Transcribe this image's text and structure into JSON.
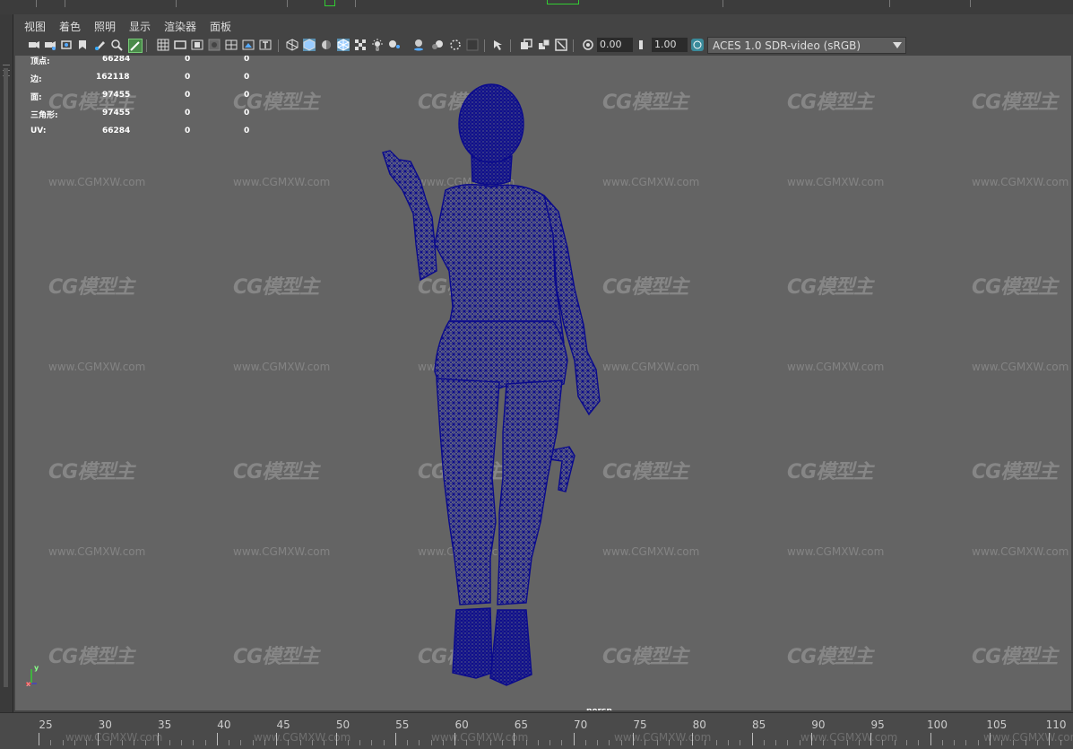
{
  "menu": {
    "items": [
      "视图",
      "着色",
      "照明",
      "显示",
      "渲染器",
      "面板"
    ]
  },
  "toolbar": {
    "exposure_value": "0.00",
    "gamma_value": "1.00",
    "color_space": "ACES 1.0 SDR-video (sRGB)"
  },
  "hud": {
    "rows": [
      {
        "label": "顶点:",
        "v1": "66284",
        "v2": "0",
        "v3": "0"
      },
      {
        "label": "边:",
        "v1": "162118",
        "v2": "0",
        "v3": "0"
      },
      {
        "label": "面:",
        "v1": "97455",
        "v2": "0",
        "v3": "0"
      },
      {
        "label": "三角形:",
        "v1": "97455",
        "v2": "0",
        "v3": "0"
      },
      {
        "label": "UV:",
        "v1": "66284",
        "v2": "0",
        "v3": "0"
      }
    ]
  },
  "viewport": {
    "camera": "persp",
    "axis_y": "y",
    "axis_x": "x",
    "wireframe_color": "#0a0a8c"
  },
  "watermark": {
    "logo": "CG模型主",
    "url": "www.CGMXW.com"
  },
  "timeline": {
    "labels": [
      "25",
      "30",
      "35",
      "40",
      "45",
      "50",
      "55",
      "60",
      "65",
      "70",
      "75",
      "80",
      "85",
      "90",
      "95",
      "100",
      "105",
      "110"
    ]
  }
}
